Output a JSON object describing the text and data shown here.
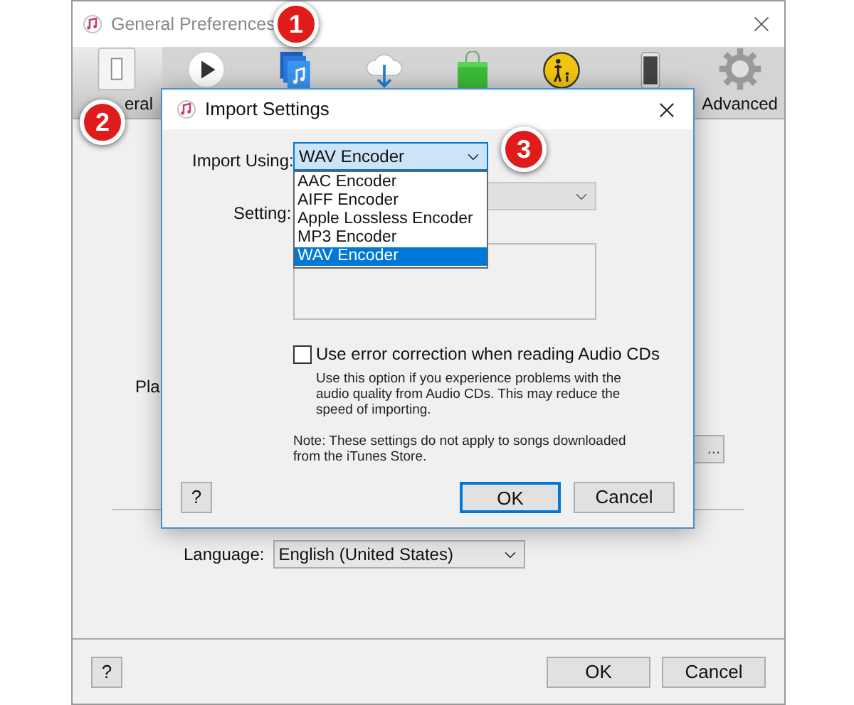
{
  "window": {
    "title": "General Preferences"
  },
  "toolbar": {
    "tabs": [
      {
        "kind": "general",
        "label": "eral",
        "selected": true
      },
      {
        "kind": "playback",
        "selected": false
      },
      {
        "kind": "sharing",
        "selected": false
      },
      {
        "kind": "downloads",
        "selected": false
      },
      {
        "kind": "store",
        "selected": false
      },
      {
        "kind": "restrictions",
        "selected": false
      },
      {
        "kind": "devices",
        "selected": false
      },
      {
        "kind": "advanced",
        "label": "Advanced",
        "selected": false
      }
    ]
  },
  "content": {
    "cut_label": "Pla",
    "cut_button": "...",
    "language": {
      "label": "Language:",
      "value": "English (United States)"
    }
  },
  "buttons": {
    "help": "?",
    "ok": "OK",
    "cancel": "Cancel"
  },
  "dialog": {
    "title": "Import Settings",
    "import_using": {
      "label": "Import Using:",
      "value": "WAV Encoder",
      "expanded": true,
      "options": [
        {
          "label": "AAC Encoder",
          "selected": false
        },
        {
          "label": "AIFF Encoder",
          "selected": false
        },
        {
          "label": "Apple Lossless Encoder",
          "selected": false
        },
        {
          "label": "MP3 Encoder",
          "selected": false
        },
        {
          "label": "WAV Encoder",
          "selected": true
        }
      ]
    },
    "setting": {
      "label": "Setting:"
    },
    "checkbox": {
      "label": "Use error correction when reading Audio CDs",
      "checked": false
    },
    "description": "Use this option if you experience problems with the audio quality from Audio CDs.  This may reduce the speed of importing.",
    "note": "Note: These settings do not apply to songs downloaded from the iTunes Store.",
    "buttons": {
      "help": "?",
      "ok": "OK",
      "cancel": "Cancel"
    }
  },
  "callouts": [
    "1",
    "2",
    "3"
  ]
}
